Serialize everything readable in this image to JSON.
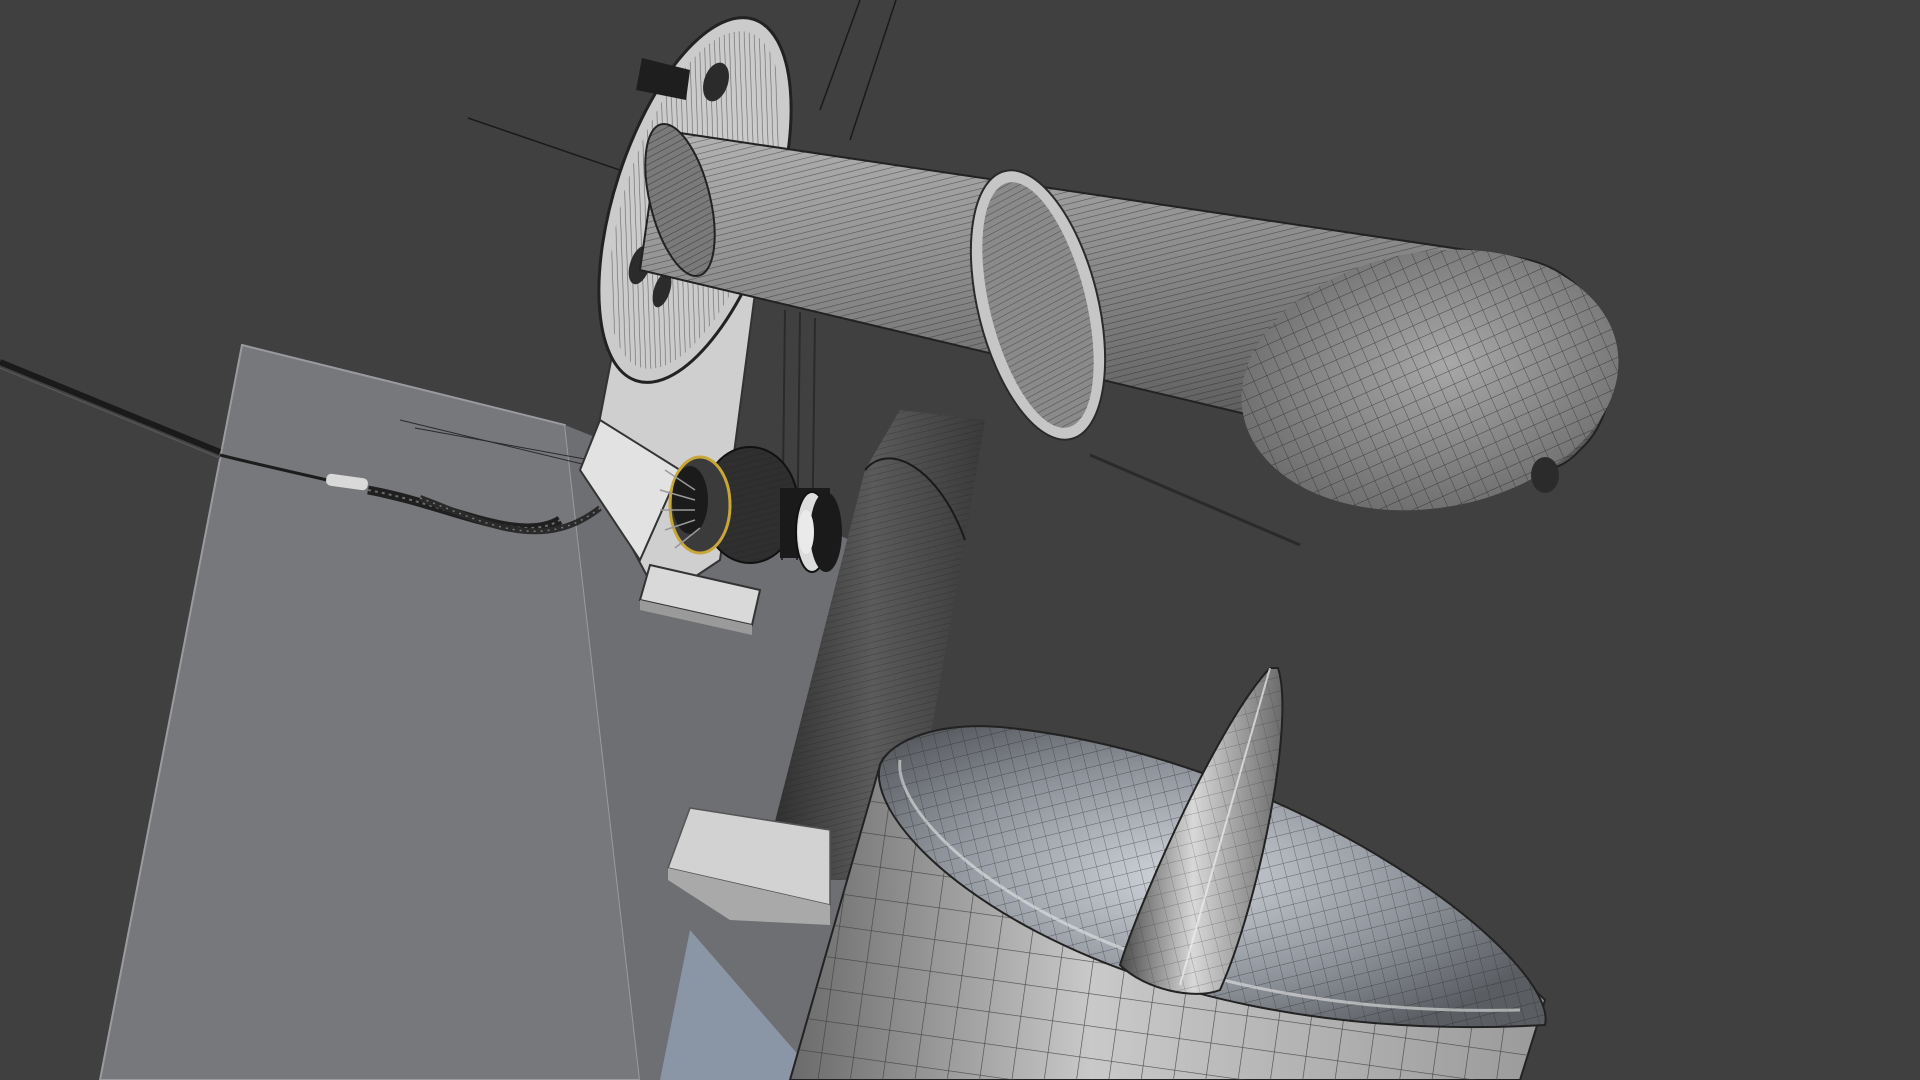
{
  "viewport": {
    "shading": "solid-wireframe",
    "background_color": "#404040"
  },
  "colors": {
    "background": "#404040",
    "plane_gray": "#77787b",
    "plane_edge": "#9a9b9e",
    "wire_dark": "#1c1c1c",
    "metal_light": "#c8c8c8",
    "metal_mid": "#8e8e8e",
    "metal_dark": "#3a3a3a",
    "accent_gold": "#c8a63a"
  },
  "objects": [
    {
      "name": "wheel-disc",
      "type": "mesh"
    },
    {
      "name": "main-tube-body",
      "type": "mesh"
    },
    {
      "name": "support-bracket",
      "type": "mesh"
    },
    {
      "name": "motor-assembly",
      "type": "mesh"
    },
    {
      "name": "cable-bundle",
      "type": "curve"
    },
    {
      "name": "vertical-post",
      "type": "mesh"
    },
    {
      "name": "base-plate",
      "type": "mesh"
    },
    {
      "name": "ground-plane",
      "type": "mesh"
    },
    {
      "name": "cup-container",
      "type": "mesh"
    },
    {
      "name": "spike-cone",
      "type": "mesh"
    }
  ]
}
